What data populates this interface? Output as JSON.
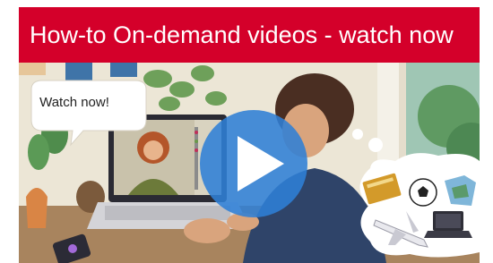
{
  "banner": {
    "title": "How-to On-demand videos - watch now",
    "background_color": "#d4002a",
    "text_color": "#ffffff"
  },
  "speech_bubble": {
    "text": "Watch now!"
  },
  "video": {
    "play_button_color": "#2f7fd6",
    "play_icon": "play-icon"
  },
  "thought_bubble": {
    "icons": [
      "book-icon",
      "soccer-ball-icon",
      "map-icon",
      "airplane-icon",
      "laptop-icon"
    ]
  }
}
